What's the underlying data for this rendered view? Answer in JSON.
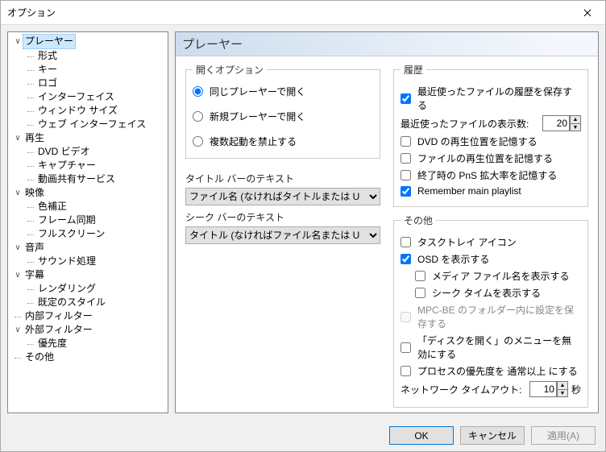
{
  "window": {
    "title": "オプション"
  },
  "tree": {
    "player": {
      "label": "プレーヤー",
      "items": [
        "形式",
        "キー",
        "ロゴ",
        "インターフェイス",
        "ウィンドウ サイズ",
        "ウェブ インターフェイス"
      ]
    },
    "playback": {
      "label": "再生",
      "items": [
        "DVD ビデオ",
        "キャプチャー",
        "動画共有サービス"
      ]
    },
    "video": {
      "label": "映像",
      "items": [
        "色補正",
        "フレーム同期",
        "フルスクリーン"
      ]
    },
    "audio": {
      "label": "音声",
      "items": [
        "サウンド処理"
      ]
    },
    "subtitles": {
      "label": "字幕",
      "items": [
        "レンダリング",
        "既定のスタイル"
      ]
    },
    "internal_filters": "内部フィルター",
    "external_filters": {
      "label": "外部フィルター",
      "items": [
        "優先度"
      ]
    },
    "other": "その他"
  },
  "page": {
    "title": "プレーヤー",
    "open_options": {
      "legend": "開くオプション",
      "same_player": "同じプレーヤーで開く",
      "new_player": "新規プレーヤーで開く",
      "no_multi": "複数起動を禁止する"
    },
    "titlebar_label": "タイトル バーのテキスト",
    "titlebar_value": "ファイル名 (なければタイトルまたは U",
    "seekbar_label": "シーク バーのテキスト",
    "seekbar_value": "タイトル (なければファイル名または U",
    "history": {
      "legend": "履歴",
      "save_recent": "最近使ったファイルの履歴を保存する",
      "recent_count_label": "最近使ったファイルの表示数:",
      "recent_count": "20",
      "remember_dvd": "DVD の再生位置を記憶する",
      "remember_file": "ファイルの再生位置を記憶する",
      "remember_pns": "終了時の PnS 拡大率を記憶する",
      "remember_playlist": "Remember main playlist"
    },
    "other": {
      "legend": "その他",
      "tray_icon": "タスクトレイ アイコン",
      "show_osd": "OSD を表示する",
      "osd_filename": "メディア ファイル名を表示する",
      "osd_seektime": "シーク タイムを表示する",
      "mpc_folder": "MPC-BE のフォルダー内に設定を保存する",
      "disable_disc_menu": "「ディスクを開く」のメニューを無効にする",
      "process_priority": "プロセスの優先度を 通常以上 にする",
      "network_timeout_label": "ネットワーク タイムアウト:",
      "network_timeout": "10",
      "seconds": "秒"
    }
  },
  "buttons": {
    "ok": "OK",
    "cancel": "キャンセル",
    "apply": "適用(A)"
  }
}
